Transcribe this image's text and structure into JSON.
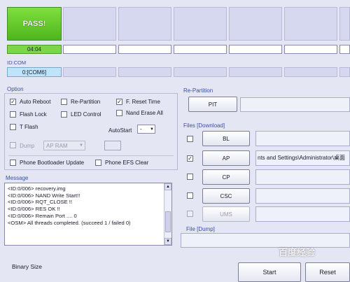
{
  "status": {
    "pass_label": "PASS!",
    "elapsed": "04:04"
  },
  "com": {
    "id_label": "ID:COM",
    "port": "0:[COM6]"
  },
  "option": {
    "title": "Option",
    "auto_reboot": "Auto Reboot",
    "re_partition": "Re-Partition",
    "f_reset_time": "F. Reset Time",
    "flash_lock": "Flash Lock",
    "led_control": "LED Control",
    "nand_erase_all": "Nand Erase All",
    "t_flash": "T Flash",
    "autostart_label": "AutoStart",
    "autostart_value": "-",
    "dump": "Dump",
    "dump_target": "AP RAM",
    "phone_bootloader_update": "Phone Bootloader Update",
    "phone_efs_clear": "Phone EFS Clear"
  },
  "message": {
    "title": "Message",
    "lines": [
      "<ID:0/006> recovery.img",
      "<ID:0/006> NAND Write Start!!",
      "<ID:0/006> RQT_CLOSE !!",
      "<ID:0/006> RES OK !!",
      "<ID:0/006> Remain Port ....  0",
      "<OSM> All threads completed. (succeed 1 / failed 0)"
    ]
  },
  "repartition": {
    "title": "Re-Partition",
    "pit_label": "PIT"
  },
  "files": {
    "title": "Files [Download]",
    "bl_label": "BL",
    "ap_label": "AP",
    "ap_path": "nts and Settings\\Administrator\\桌面",
    "cp_label": "CP",
    "csc_label": "CSC",
    "ums_label": "UMS"
  },
  "dump": {
    "title": "File [Dump]"
  },
  "footer": {
    "binary_size": "Binary Size",
    "start": "Start",
    "reset": "Reset"
  },
  "watermark": "百度经验",
  "colors": {
    "pass_green": "#5cc72a",
    "background": "#e4e6f3",
    "accent_blue": "#3a4fa0"
  }
}
